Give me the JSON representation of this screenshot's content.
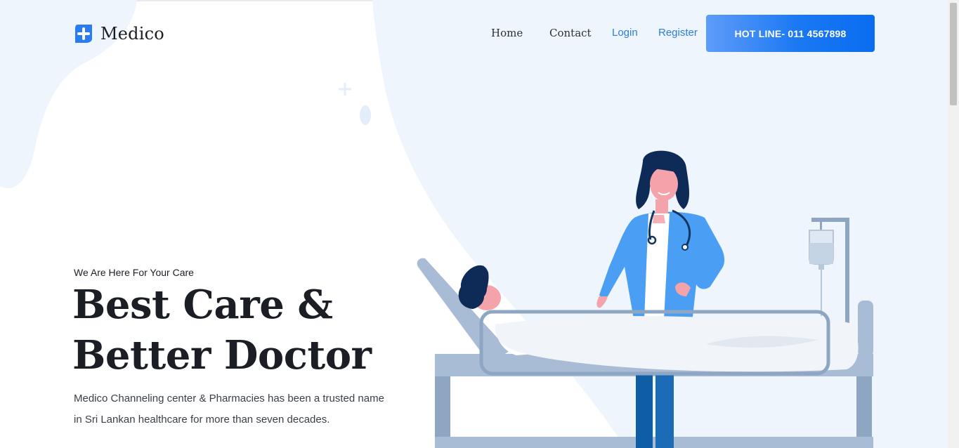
{
  "brand": {
    "name": "Medico",
    "icon": "medical-cross-icon"
  },
  "nav": {
    "home": "Home",
    "contact": "Contact",
    "login": "Login",
    "register": "Register",
    "hotline": "HOT LINE- 011 4567898"
  },
  "hero": {
    "eyebrow": "We Are Here For Your Care",
    "headline_line1": "Best Care &",
    "headline_line2": "Better Doctor",
    "description_line1": "Medico Channeling center & Pharmacies has been a trusted name",
    "description_line2": "in Sri Lankan healthcare for more than seven decades."
  },
  "colors": {
    "accent": "#1a78f2",
    "link": "#2b7de0",
    "text_dark": "#1b1e24",
    "background_blob": "#eef5fd"
  }
}
